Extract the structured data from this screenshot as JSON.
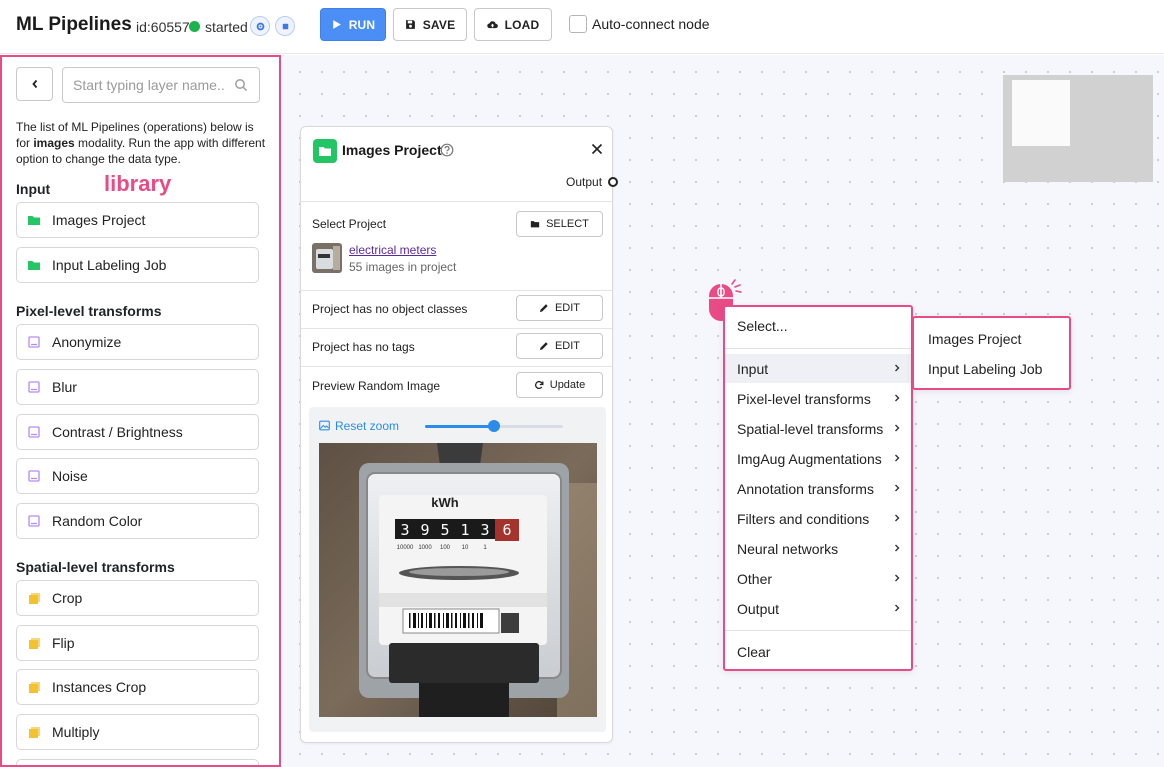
{
  "header": {
    "title": "ML Pipelines",
    "app_id": "id:60557",
    "status": "started",
    "run_label": "RUN",
    "save_label": "SAVE",
    "load_label": "LOAD",
    "autoconnect_label": "Auto-connect node"
  },
  "sidebar": {
    "search_placeholder": "Start typing layer name..",
    "description_pre": "The list of ML Pipelines (operations) below is for ",
    "description_bold": "images",
    "description_post": " modality. Run the app with different option to change the data type.",
    "annotation": "library",
    "sections": [
      {
        "title": "Input",
        "items": [
          {
            "label": "Images Project",
            "icon": "folder-icon"
          },
          {
            "label": "Input Labeling Job",
            "icon": "folder-icon"
          }
        ]
      },
      {
        "title": "Pixel-level transforms",
        "items": [
          {
            "label": "Anonymize",
            "icon": "image-icon"
          },
          {
            "label": "Blur",
            "icon": "image-icon"
          },
          {
            "label": "Contrast / Brightness",
            "icon": "image-icon"
          },
          {
            "label": "Noise",
            "icon": "image-icon"
          },
          {
            "label": "Random Color",
            "icon": "image-icon"
          }
        ]
      },
      {
        "title": "Spatial-level transforms",
        "items": [
          {
            "label": "Crop",
            "icon": "layers-icon"
          },
          {
            "label": "Flip",
            "icon": "layers-icon"
          },
          {
            "label": "Instances Crop",
            "icon": "layers-icon"
          },
          {
            "label": "Multiply",
            "icon": "layers-icon"
          }
        ]
      }
    ]
  },
  "node": {
    "title": "Images Project",
    "output_label": "Output",
    "select_project_label": "Select Project",
    "select_button": "SELECT",
    "project_name": "electrical meters",
    "project_count": "55 images in project",
    "classes_label": "Project has no object classes",
    "tags_label": "Project has no tags",
    "edit_button": "EDIT",
    "preview_label": "Preview Random Image",
    "update_button": "Update",
    "reset_zoom_label": "Reset zoom",
    "zoom_level": 0.5
  },
  "meter_image": {
    "unit": "kWh",
    "digits": [
      "3",
      "9",
      "5",
      "1",
      "3",
      "6"
    ],
    "scale": [
      "10000",
      "1000",
      "100",
      "10",
      "1"
    ]
  },
  "context_menu": {
    "items": [
      {
        "label": "Select...",
        "has_submenu": false
      },
      {
        "label": "Input",
        "has_submenu": true,
        "active": true
      },
      {
        "label": "Pixel-level transforms",
        "has_submenu": true
      },
      {
        "label": "Spatial-level transforms",
        "has_submenu": true
      },
      {
        "label": "ImgAug Augmentations",
        "has_submenu": true
      },
      {
        "label": "Annotation transforms",
        "has_submenu": true
      },
      {
        "label": "Filters and conditions",
        "has_submenu": true
      },
      {
        "label": "Neural networks",
        "has_submenu": true
      },
      {
        "label": "Other",
        "has_submenu": true
      },
      {
        "label": "Output",
        "has_submenu": true
      },
      {
        "label": "Clear",
        "has_submenu": false
      }
    ],
    "submenu": [
      "Images Project",
      "Input Labeling Job"
    ]
  },
  "colors": {
    "accent": "#e94b86",
    "run_button": "#4b8ef6",
    "status_ok": "#1ab34c",
    "folder": "#24c564",
    "image_icon": "#b48cf0",
    "layers_icon": "#f2c230",
    "link": "#2a8ce8"
  }
}
